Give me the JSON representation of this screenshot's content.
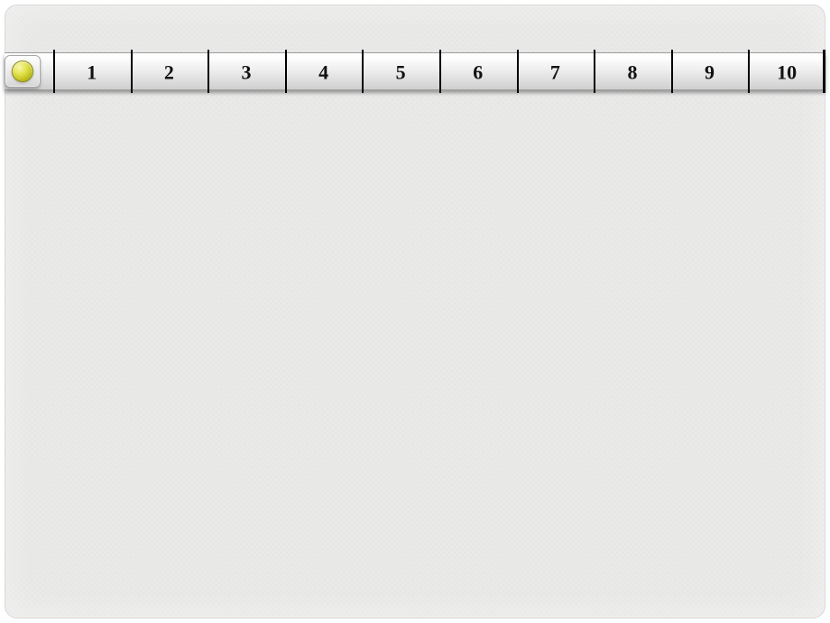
{
  "ruler": {
    "ticks": [
      "1",
      "2",
      "3",
      "4",
      "5",
      "6",
      "7",
      "8",
      "9",
      "10"
    ]
  }
}
